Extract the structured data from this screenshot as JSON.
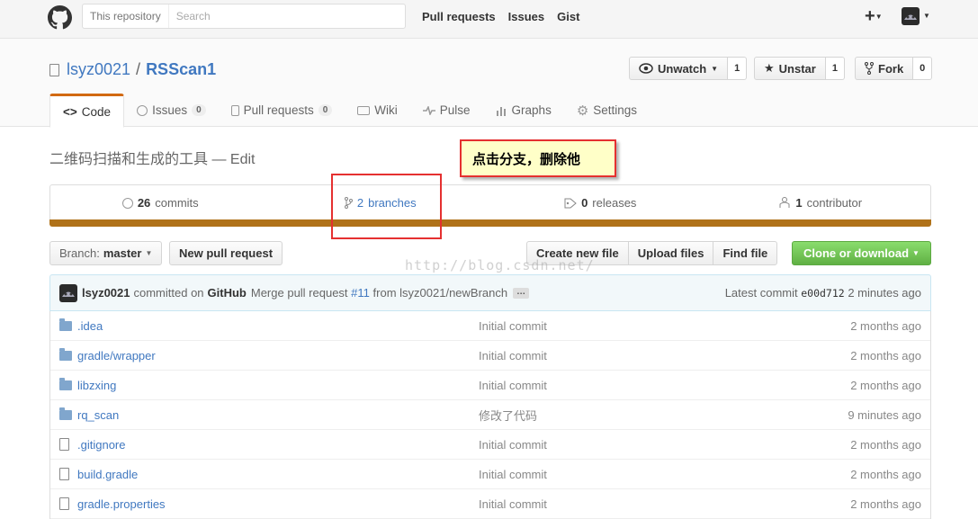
{
  "header": {
    "search_scope": "This repository",
    "search_placeholder": "Search",
    "nav": [
      "Pull requests",
      "Issues",
      "Gist"
    ],
    "plus": "+"
  },
  "repo": {
    "owner": "lsyz0021",
    "separator": "/",
    "name": "RSScan1",
    "watch_label": "Unwatch",
    "watch_count": "1",
    "star_label": "Unstar",
    "star_count": "1",
    "fork_label": "Fork",
    "fork_count": "0"
  },
  "tabs": [
    {
      "label": "Code",
      "icon": "code-icon"
    },
    {
      "label": "Issues",
      "count": "0",
      "icon": "issue-icon"
    },
    {
      "label": "Pull requests",
      "count": "0",
      "icon": "pull-request-icon"
    },
    {
      "label": "Wiki",
      "icon": "book-icon"
    },
    {
      "label": "Pulse",
      "icon": "pulse-icon"
    },
    {
      "label": "Graphs",
      "icon": "graph-icon"
    },
    {
      "label": "Settings",
      "icon": "gear-icon"
    }
  ],
  "description": {
    "text": "二维码扫描和生成的工具",
    "dash": " — ",
    "edit": "Edit"
  },
  "annotation": "点击分支，删除他",
  "summary": {
    "commits_count": "26",
    "commits_label": "commits",
    "branches_count": "2",
    "branches_label": "branches",
    "releases_count": "0",
    "releases_label": "releases",
    "contributors_count": "1",
    "contributors_label": "contributor"
  },
  "lang_color": "#b07219",
  "file_nav": {
    "branch_prefix": "Branch:",
    "branch_name": "master",
    "new_pr": "New pull request",
    "create_file": "Create new file",
    "upload_files": "Upload files",
    "find_file": "Find file",
    "clone": "Clone or download"
  },
  "watermark": "http://blog.csdn.net/",
  "commit": {
    "user": "lsyz0021",
    "committed_on": "committed on",
    "platform": "GitHub",
    "msg_prefix": "Merge pull request",
    "pr_link": "#11",
    "msg_suffix": "from lsyz0021/newBranch",
    "ellipsis": "…",
    "latest_label": "Latest commit",
    "sha": "e00d712",
    "age": "2 minutes ago"
  },
  "files": [
    {
      "type": "folder",
      "name": ".idea",
      "message": "Initial commit",
      "age": "2 months ago"
    },
    {
      "type": "folder",
      "name": "gradle/wrapper",
      "message": "Initial commit",
      "age": "2 months ago"
    },
    {
      "type": "folder",
      "name": "libzxing",
      "message": "Initial commit",
      "age": "2 months ago"
    },
    {
      "type": "folder",
      "name": "rq_scan",
      "message": "修改了代码",
      "age": "9 minutes ago"
    },
    {
      "type": "file",
      "name": ".gitignore",
      "message": "Initial commit",
      "age": "2 months ago"
    },
    {
      "type": "file",
      "name": "build.gradle",
      "message": "Initial commit",
      "age": "2 months ago"
    },
    {
      "type": "file",
      "name": "gradle.properties",
      "message": "Initial commit",
      "age": "2 months ago"
    }
  ]
}
